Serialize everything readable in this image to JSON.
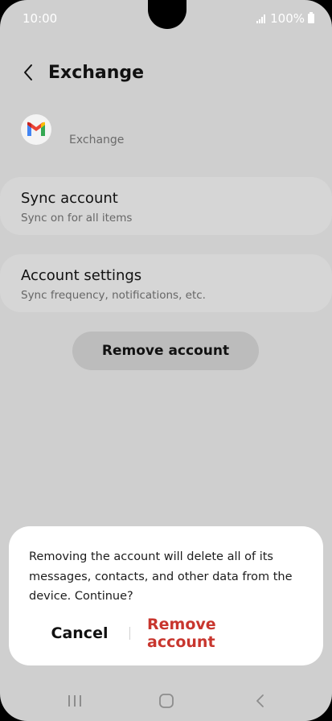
{
  "status_bar": {
    "time": "10:00",
    "battery": "100%"
  },
  "header": {
    "title": "Exchange"
  },
  "account": {
    "type_label": "Exchange",
    "icon": "gmail-icon"
  },
  "settings_items": [
    {
      "title": "Sync account",
      "subtitle": "Sync on for all items"
    },
    {
      "title": "Account settings",
      "subtitle": "Sync frequency, notifications, etc."
    }
  ],
  "remove_button_label": "Remove account",
  "dialog": {
    "message": "Removing the account will delete all of its messages, contacts, and other data from the device. Continue?",
    "cancel_label": "Cancel",
    "confirm_label": "Remove account"
  },
  "colors": {
    "background": "#cfcfcf",
    "card": "#d6d6d6",
    "destructive": "#c8362e"
  },
  "nav_icons": [
    "recent-apps-icon",
    "home-icon",
    "back-nav-icon"
  ]
}
